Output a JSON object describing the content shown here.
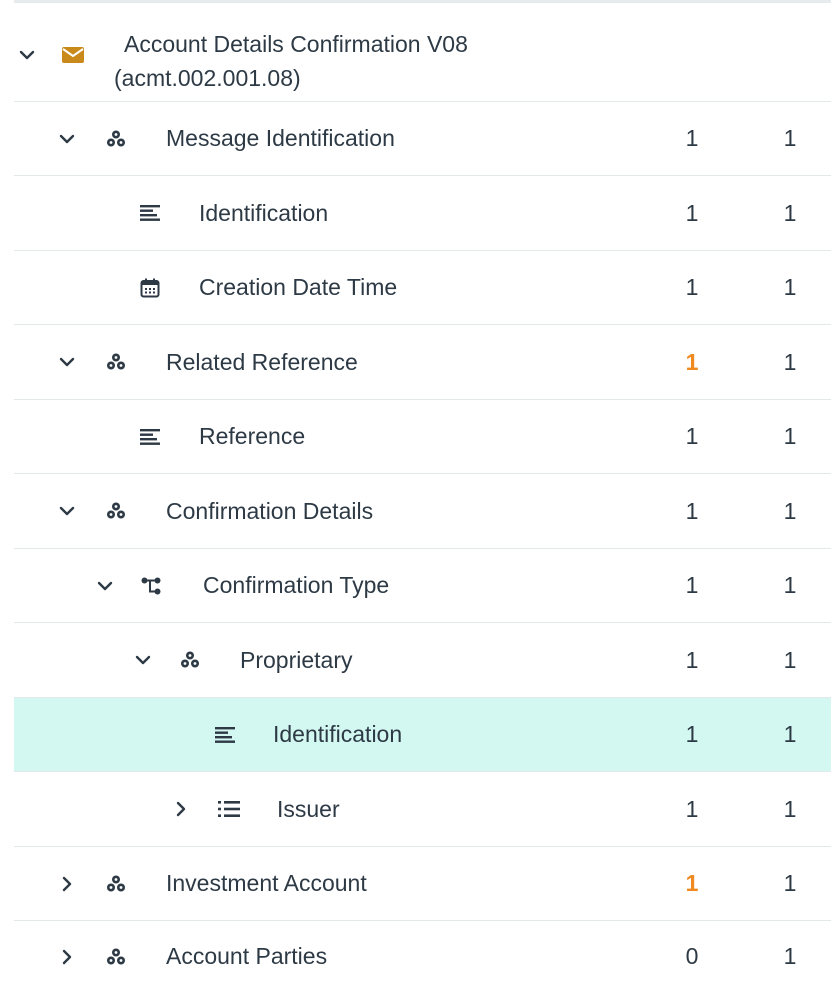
{
  "root": {
    "label_line1": "Account Details Confirmation V08",
    "label_line2": "(acmt.002.001.08)",
    "icon": "envelope-icon",
    "expanded": true
  },
  "rows": [
    {
      "label": "Message Identification",
      "icon": "component-icon",
      "expander": "expanded",
      "min": "1",
      "max": "1",
      "min_warn": false
    },
    {
      "label": "Identification",
      "icon": "text-field-icon",
      "expander": "none",
      "min": "1",
      "max": "1",
      "min_warn": false
    },
    {
      "label": "Creation Date Time",
      "icon": "calendar-icon",
      "expander": "none",
      "min": "1",
      "max": "1",
      "min_warn": false
    },
    {
      "label": "Related Reference",
      "icon": "component-icon",
      "expander": "expanded",
      "min": "1",
      "max": "1",
      "min_warn": true
    },
    {
      "label": "Reference",
      "icon": "text-field-icon",
      "expander": "none",
      "min": "1",
      "max": "1",
      "min_warn": false
    },
    {
      "label": "Confirmation Details",
      "icon": "component-icon",
      "expander": "expanded",
      "min": "1",
      "max": "1",
      "min_warn": false
    },
    {
      "label": "Confirmation Type",
      "icon": "choice-icon",
      "expander": "expanded",
      "min": "1",
      "max": "1",
      "min_warn": false
    },
    {
      "label": "Proprietary",
      "icon": "component-icon",
      "expander": "expanded",
      "min": "1",
      "max": "1",
      "min_warn": false
    },
    {
      "label": "Identification",
      "icon": "text-field-icon",
      "expander": "none",
      "min": "1",
      "max": "1",
      "min_warn": false,
      "selected": true
    },
    {
      "label": "Issuer",
      "icon": "list-icon",
      "expander": "collapsed",
      "min": "1",
      "max": "1",
      "min_warn": false
    },
    {
      "label": "Investment Account",
      "icon": "component-icon",
      "expander": "collapsed",
      "min": "1",
      "max": "1",
      "min_warn": true
    },
    {
      "label": "Account Parties",
      "icon": "component-icon",
      "expander": "collapsed",
      "min": "0",
      "max": "1",
      "min_warn": false
    }
  ],
  "colors": {
    "text": "#2d3a45",
    "warning": "#f0891f",
    "selected_row": "#d3f7f1",
    "envelope": "#c98a1b",
    "divider": "#e3e8eb"
  }
}
